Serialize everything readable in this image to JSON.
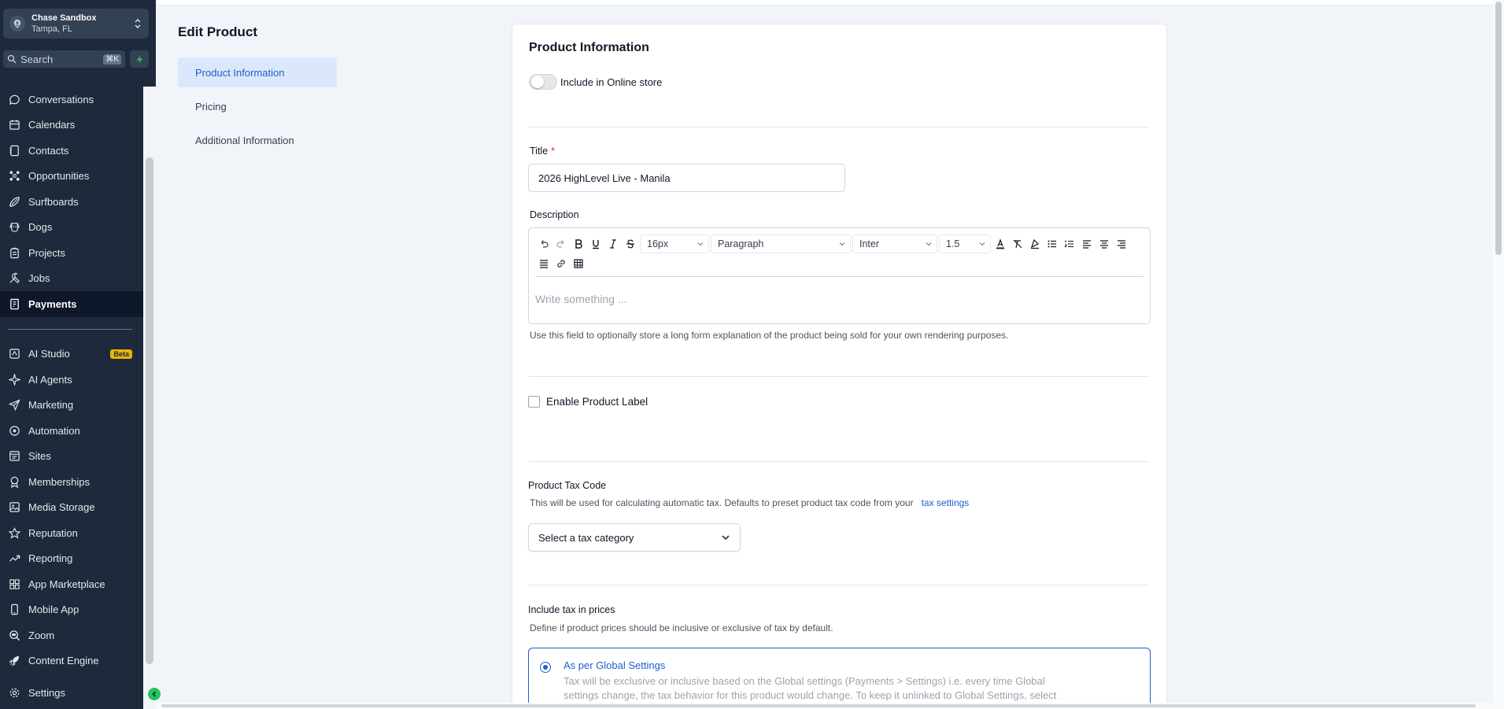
{
  "account": {
    "name": "Chase Sandbox",
    "location": "Tampa, FL"
  },
  "search": {
    "placeholder": "Search",
    "shortcut": "⌘K"
  },
  "sidebar": {
    "items": [
      {
        "label": "Conversations",
        "icon": "chat-icon"
      },
      {
        "label": "Calendars",
        "icon": "calendar-icon"
      },
      {
        "label": "Contacts",
        "icon": "contacts-icon"
      },
      {
        "label": "Opportunities",
        "icon": "opportunities-icon"
      },
      {
        "label": "Surfboards",
        "icon": "surfboard-icon"
      },
      {
        "label": "Dogs",
        "icon": "dog-icon"
      },
      {
        "label": "Projects",
        "icon": "clipboard-icon"
      },
      {
        "label": "Jobs",
        "icon": "tools-icon"
      },
      {
        "label": "Payments",
        "icon": "payments-icon",
        "active": true
      }
    ],
    "items2": [
      {
        "label": "AI Studio",
        "icon": "ai-studio-icon",
        "badge": "Beta"
      },
      {
        "label": "AI Agents",
        "icon": "ai-agents-icon"
      },
      {
        "label": "Marketing",
        "icon": "send-icon"
      },
      {
        "label": "Automation",
        "icon": "automation-icon"
      },
      {
        "label": "Sites",
        "icon": "sites-icon"
      },
      {
        "label": "Memberships",
        "icon": "award-icon"
      },
      {
        "label": "Media Storage",
        "icon": "image-icon"
      },
      {
        "label": "Reputation",
        "icon": "star-icon"
      },
      {
        "label": "Reporting",
        "icon": "trend-icon"
      },
      {
        "label": "App Marketplace",
        "icon": "grid-icon"
      },
      {
        "label": "Mobile App",
        "icon": "mobile-icon"
      },
      {
        "label": "Zoom",
        "icon": "zoom-icon"
      },
      {
        "label": "Content Engine",
        "icon": "rocket-icon"
      }
    ],
    "settings": "Settings"
  },
  "page": {
    "title": "Edit Product",
    "subnav": [
      "Product Information",
      "Pricing",
      "Additional Information"
    ]
  },
  "card": {
    "title": "Product Information",
    "online_store_label": "Include in Online store",
    "title_label": "Title",
    "title_required": "*",
    "title_value": "2026 HighLevel Live - Manila",
    "description_label": "Description",
    "toolbar": {
      "font_size": "16px",
      "block": "Paragraph",
      "font": "Inter",
      "line_height": "1.5"
    },
    "editor_placeholder": "Write something ...",
    "description_help": "Use this field to optionally store a long form explanation of the product being sold for your own rendering purposes.",
    "product_label_checkbox": "Enable Product Label",
    "tax_code_label": "Product Tax Code",
    "tax_code_help": "This will be used for calculating automatic tax. Defaults to preset product tax code from your",
    "tax_settings_link": "tax settings",
    "tax_select_placeholder": "Select a tax category",
    "include_tax_label": "Include tax in prices",
    "include_tax_help": "Define if product prices should be inclusive or exclusive of tax by default.",
    "radio_title": "As per Global Settings",
    "radio_desc": "Tax will be exclusive or inclusive based on the Global settings (Payments > Settings) i.e. every time Global settings change, the tax behavior for this product would change. To keep it unlinked to Global Settings, select \"Include/Exclude tax\" options."
  },
  "colors": {
    "sidebar_bg": "#1e2a3b",
    "accent": "#1d5fc9",
    "active_subnav": "#dbe8fb"
  }
}
